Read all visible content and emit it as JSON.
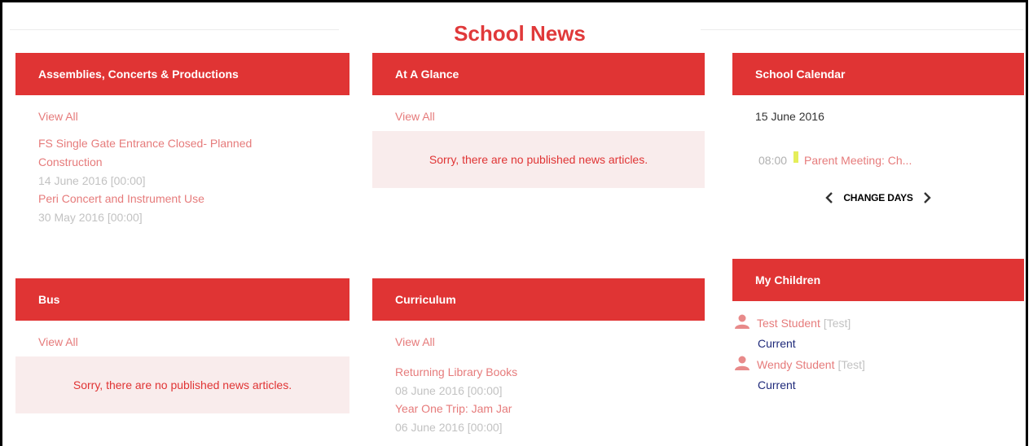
{
  "page_title": "School News",
  "panels": {
    "assemblies": {
      "header": "Assemblies, Concerts & Productions",
      "view_all": "View All",
      "articles": [
        {
          "title": "FS Single Gate Entrance Closed- Planned Construction",
          "date": "14 June 2016 [00:00]"
        },
        {
          "title": "Peri Concert and Instrument Use",
          "date": "30 May 2016 [00:00]"
        }
      ]
    },
    "at_a_glance": {
      "header": "At A Glance",
      "view_all": "View All",
      "empty_message": "Sorry, there are no published news articles."
    },
    "calendar": {
      "header": "School Calendar",
      "date": "15 June 2016",
      "event_time": "08:00",
      "event_title": "Parent Meeting: Ch...",
      "change_days": "CHANGE DAYS"
    },
    "bus": {
      "header": "Bus",
      "view_all": "View All",
      "empty_message": "Sorry, there are no published news articles."
    },
    "curriculum": {
      "header": "Curriculum",
      "view_all": "View All",
      "articles": [
        {
          "title": "Returning Library Books",
          "date": "08 June 2016 [00:00]"
        },
        {
          "title": "Year One Trip: Jam Jar",
          "date": "06 June 2016 [00:00]"
        }
      ]
    },
    "my_children": {
      "header": "My Children",
      "children": [
        {
          "name": "Test Student",
          "tag": "[Test]",
          "status": "Current"
        },
        {
          "name": "Wendy Student",
          "tag": "[Test]",
          "status": "Current"
        }
      ]
    }
  },
  "icons": {
    "prev": "chevron-left-icon",
    "next": "chevron-right-icon",
    "person": "person-icon"
  },
  "colors": {
    "accent": "#e03434",
    "link": "#e67b7b",
    "muted": "#c2c2c2",
    "status": "#1f2a7a",
    "event_marker": "#e5ee5a"
  }
}
